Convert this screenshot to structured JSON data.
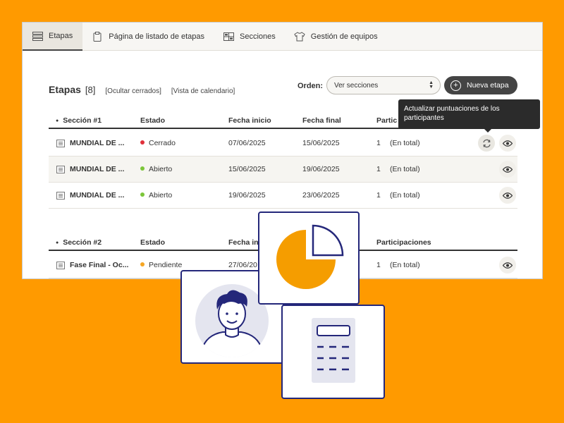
{
  "tabs": [
    {
      "label": "Etapas",
      "icon": "stack-icon",
      "active": true
    },
    {
      "label": "Página de listado de etapas",
      "icon": "clipboard-icon"
    },
    {
      "label": "Secciones",
      "icon": "grid-icon"
    },
    {
      "label": "Gestión de equipos",
      "icon": "shirt-icon"
    }
  ],
  "header": {
    "title": "Etapas",
    "count": "[8]",
    "hide_closed": "[Ocultar cerrados]",
    "calendar_view": "[Vista de calendario]",
    "order_label": "Orden:",
    "order_value": "Ver secciones",
    "new_button": "Nueva etapa"
  },
  "tooltip": "Actualizar puntuaciones de los participantes",
  "sections": [
    {
      "heading": "Sección #1",
      "columns": [
        "Estado",
        "Fecha inicio",
        "Fecha final",
        "Partic"
      ],
      "rows": [
        {
          "name": "MUNDIAL DE ...",
          "status": "Cerrado",
          "status_color": "#e0303a",
          "start": "07/06/2025",
          "end": "15/06/2025",
          "count": "1",
          "count_note": "(En total)"
        },
        {
          "name": "MUNDIAL DE ...",
          "status": "Abierto",
          "status_color": "#7cc63a",
          "start": "15/06/2025",
          "end": "19/06/2025",
          "count": "1",
          "count_note": "(En total)"
        },
        {
          "name": "MUNDIAL DE ...",
          "status": "Abierto",
          "status_color": "#7cc63a",
          "start": "19/06/2025",
          "end": "23/06/2025",
          "count": "1",
          "count_note": "(En total)"
        }
      ]
    },
    {
      "heading": "Sección #2",
      "columns": [
        "Estado",
        "Fecha ini",
        "Participaciones"
      ],
      "rows": [
        {
          "name": "Fase Final - Oc...",
          "status": "Pendiente",
          "status_color": "#f5a623",
          "start": "27/06/20",
          "count": "1",
          "count_note": "(En total)"
        }
      ]
    }
  ],
  "colors": {
    "background": "#ff9a00",
    "card_border": "#24277a",
    "pie": "#f59d00"
  }
}
